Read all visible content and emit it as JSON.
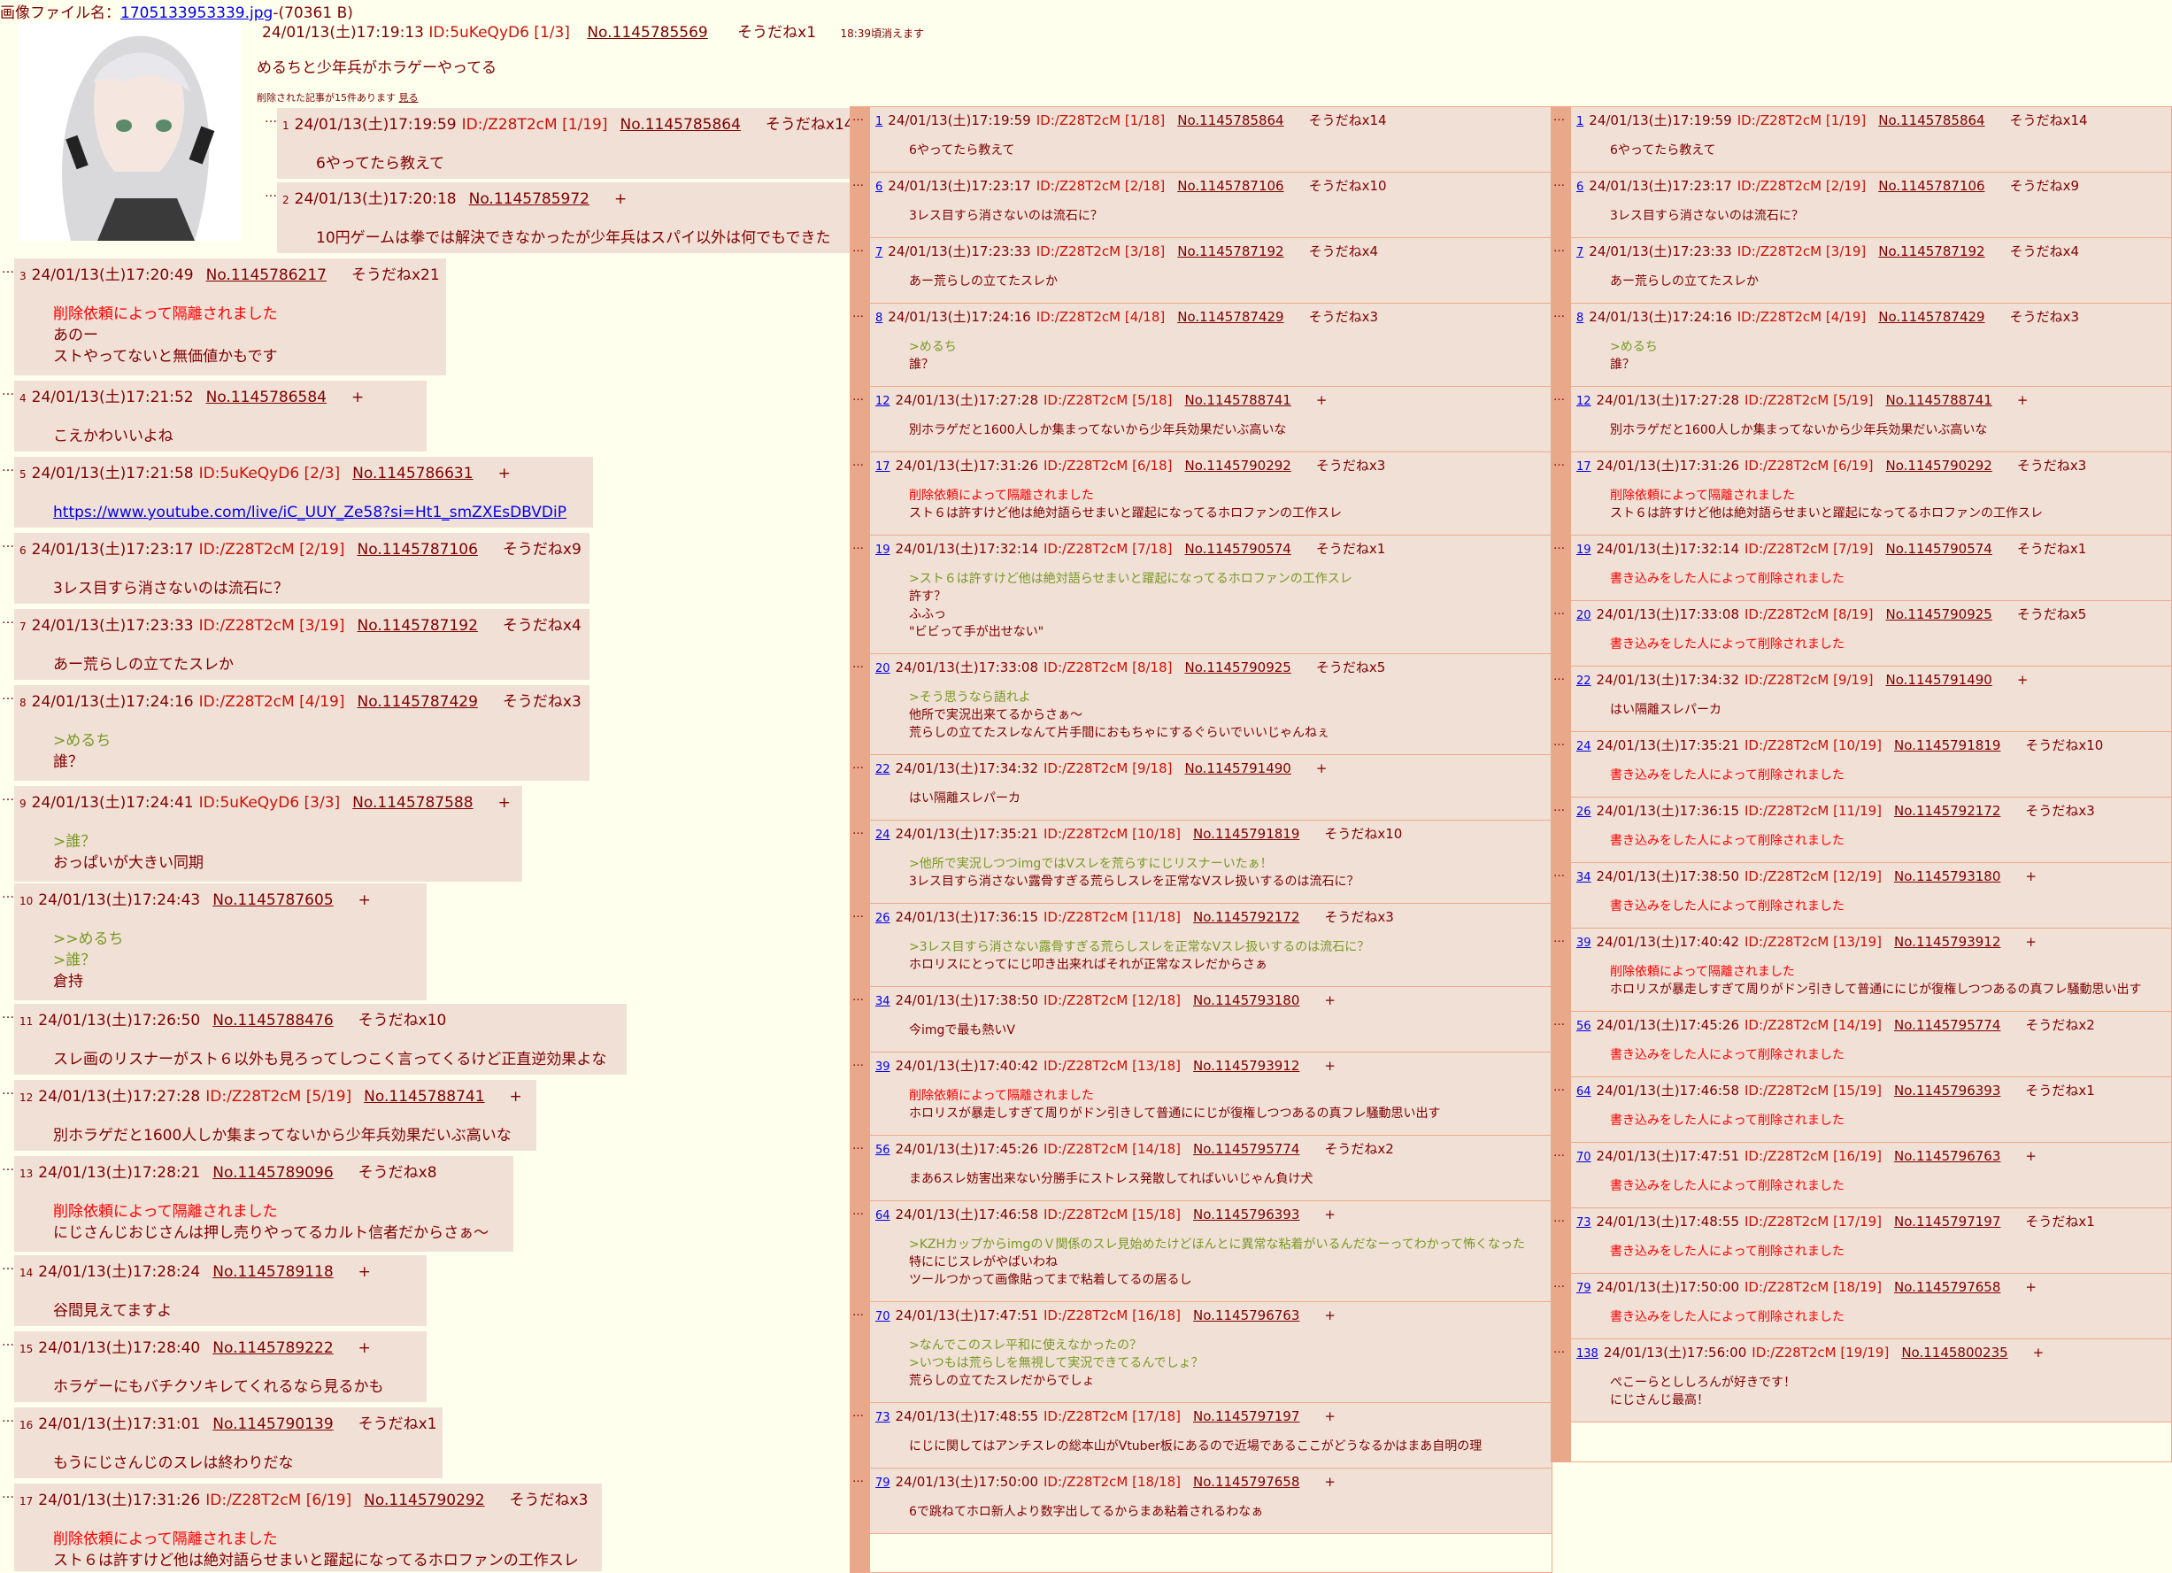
{
  "file": {
    "label": "画像ファイル名：",
    "name": "1705133953339.jpg",
    "size": "-(70361 B)"
  },
  "op": {
    "date": "24/01/13(土)17:19:13",
    "id": "ID:5uKeQyD6 [1/3]",
    "no": "No.1145785569",
    "sod": "そうだねx1",
    "expire": "18:39頃消えます",
    "body": "めるちと少年兵がホラゲーやってる",
    "deleted_note": "削除された記事が15件あります",
    "deleted_link": "見る"
  },
  "thread": [
    {
      "n": "1",
      "date": "24/01/13(土)17:19:59",
      "id": "ID:/Z28T2cM [1/19]",
      "no": "No.1145785864",
      "sod": "そうだねx14",
      "lines": [
        {
          "t": "6やってたら教えて",
          "k": ""
        }
      ]
    },
    {
      "n": "2",
      "date": "24/01/13(土)17:20:18",
      "id": "",
      "no": "No.1145785972",
      "sod": "+",
      "lines": [
        {
          "t": "10円ゲームは拳では解決できなかったが少年兵はスパイ以外は何でもできた",
          "k": ""
        }
      ]
    },
    {
      "n": "3",
      "date": "24/01/13(土)17:20:49",
      "id": "",
      "no": "No.1145786217",
      "sod": "そうだねx21",
      "lines": [
        {
          "t": "削除依頼によって隔離されました",
          "k": "del"
        },
        {
          "t": "あのー",
          "k": ""
        },
        {
          "t": "ストやってないと無価値かもです",
          "k": ""
        }
      ]
    },
    {
      "n": "4",
      "date": "24/01/13(土)17:21:52",
      "id": "",
      "no": "No.1145786584",
      "sod": "+",
      "lines": [
        {
          "t": "こえかわいいよね",
          "k": ""
        }
      ]
    },
    {
      "n": "5",
      "date": "24/01/13(土)17:21:58",
      "id": "ID:5uKeQyD6 [2/3]",
      "no": "No.1145786631",
      "sod": "+",
      "lines": [
        {
          "t": "https://www.youtube.com/live/iC_UUY_Ze58?si=Ht1_smZXEsDBVDiP",
          "k": "link"
        }
      ]
    },
    {
      "n": "6",
      "date": "24/01/13(土)17:23:17",
      "id": "ID:/Z28T2cM [2/19]",
      "no": "No.1145787106",
      "sod": "そうだねx9",
      "lines": [
        {
          "t": "3レス目すら消さないのは流石に？",
          "k": ""
        }
      ]
    },
    {
      "n": "7",
      "date": "24/01/13(土)17:23:33",
      "id": "ID:/Z28T2cM [3/19]",
      "no": "No.1145787192",
      "sod": "そうだねx4",
      "lines": [
        {
          "t": "あー荒らしの立てたスレか",
          "k": ""
        }
      ]
    },
    {
      "n": "8",
      "date": "24/01/13(土)17:24:16",
      "id": "ID:/Z28T2cM [4/19]",
      "no": "No.1145787429",
      "sod": "そうだねx3",
      "lines": [
        {
          "t": ">めるち",
          "k": "quote"
        },
        {
          "t": "誰？",
          "k": ""
        }
      ]
    },
    {
      "n": "9",
      "date": "24/01/13(土)17:24:41",
      "id": "ID:5uKeQyD6 [3/3]",
      "no": "No.1145787588",
      "sod": "+",
      "lines": [
        {
          "t": ">誰？",
          "k": "quote"
        },
        {
          "t": "おっぱいが大きい同期",
          "k": ""
        }
      ]
    },
    {
      "n": "10",
      "date": "24/01/13(土)17:24:43",
      "id": "",
      "no": "No.1145787605",
      "sod": "+",
      "lines": [
        {
          "t": ">>めるち",
          "k": "quote"
        },
        {
          "t": ">誰？",
          "k": "quote"
        },
        {
          "t": "倉持",
          "k": ""
        }
      ]
    },
    {
      "n": "11",
      "date": "24/01/13(土)17:26:50",
      "id": "",
      "no": "No.1145788476",
      "sod": "そうだねx10",
      "lines": [
        {
          "t": "スレ画のリスナーがスト６以外も見ろってしつこく言ってくるけど正直逆効果よな",
          "k": ""
        }
      ]
    },
    {
      "n": "12",
      "date": "24/01/13(土)17:27:28",
      "id": "ID:/Z28T2cM [5/19]",
      "no": "No.1145788741",
      "sod": "+",
      "lines": [
        {
          "t": "別ホラゲだと1600人しか集まってないから少年兵効果だいぶ高いな",
          "k": ""
        }
      ]
    },
    {
      "n": "13",
      "date": "24/01/13(土)17:28:21",
      "id": "",
      "no": "No.1145789096",
      "sod": "そうだねx8",
      "lines": [
        {
          "t": "削除依頼によって隔離されました",
          "k": "del"
        },
        {
          "t": "にじさんじおじさんは押し売りやってるカルト信者だからさぁ～",
          "k": ""
        }
      ]
    },
    {
      "n": "14",
      "date": "24/01/13(土)17:28:24",
      "id": "",
      "no": "No.1145789118",
      "sod": "+",
      "lines": [
        {
          "t": "谷間見えてますよ",
          "k": ""
        }
      ]
    },
    {
      "n": "15",
      "date": "24/01/13(土)17:28:40",
      "id": "",
      "no": "No.1145789222",
      "sod": "+",
      "lines": [
        {
          "t": "ホラゲーにもバチクソキレてくれるなら見るかも",
          "k": ""
        }
      ]
    },
    {
      "n": "16",
      "date": "24/01/13(土)17:31:01",
      "id": "",
      "no": "No.1145790139",
      "sod": "そうだねx1",
      "lines": [
        {
          "t": "もうにじさんじのスレは終わりだな",
          "k": ""
        }
      ]
    },
    {
      "n": "17",
      "date": "24/01/13(土)17:31:26",
      "id": "ID:/Z28T2cM [6/19]",
      "no": "No.1145790292",
      "sod": "そうだねx3",
      "lines": [
        {
          "t": "削除依頼によって隔離されました",
          "k": "del"
        },
        {
          "t": "スト６は許すけど他は絶対語らせまいと躍起になってるホロファンの工作スレ",
          "k": ""
        }
      ]
    }
  ],
  "col1": [
    {
      "n": "1",
      "date": "24/01/13(土)17:19:59",
      "id": "ID:/Z28T2cM [1/18]",
      "no": "No.1145785864",
      "sod": "そうだねx14",
      "lines": [
        {
          "t": "6やってたら教えて",
          "k": ""
        }
      ]
    },
    {
      "n": "6",
      "date": "24/01/13(土)17:23:17",
      "id": "ID:/Z28T2cM [2/18]",
      "no": "No.1145787106",
      "sod": "そうだねx10",
      "lines": [
        {
          "t": "3レス目すら消さないのは流石に？",
          "k": ""
        }
      ]
    },
    {
      "n": "7",
      "date": "24/01/13(土)17:23:33",
      "id": "ID:/Z28T2cM [3/18]",
      "no": "No.1145787192",
      "sod": "そうだねx4",
      "lines": [
        {
          "t": "あー荒らしの立てたスレか",
          "k": ""
        }
      ]
    },
    {
      "n": "8",
      "date": "24/01/13(土)17:24:16",
      "id": "ID:/Z28T2cM [4/18]",
      "no": "No.1145787429",
      "sod": "そうだねx3",
      "lines": [
        {
          "t": ">めるち",
          "k": "quote"
        },
        {
          "t": "誰？",
          "k": ""
        }
      ]
    },
    {
      "n": "12",
      "date": "24/01/13(土)17:27:28",
      "id": "ID:/Z28T2cM [5/18]",
      "no": "No.1145788741",
      "sod": "+",
      "lines": [
        {
          "t": "別ホラゲだと1600人しか集まってないから少年兵効果だいぶ高いな",
          "k": ""
        }
      ]
    },
    {
      "n": "17",
      "date": "24/01/13(土)17:31:26",
      "id": "ID:/Z28T2cM [6/18]",
      "no": "No.1145790292",
      "sod": "そうだねx3",
      "lines": [
        {
          "t": "削除依頼によって隔離されました",
          "k": "del"
        },
        {
          "t": "スト６は許すけど他は絶対語らせまいと躍起になってるホロファンの工作スレ",
          "k": ""
        }
      ]
    },
    {
      "n": "19",
      "date": "24/01/13(土)17:32:14",
      "id": "ID:/Z28T2cM [7/18]",
      "no": "No.1145790574",
      "sod": "そうだねx1",
      "lines": [
        {
          "t": ">スト６は許すけど他は絶対語らせまいと躍起になってるホロファンの工作スレ",
          "k": "quote"
        },
        {
          "t": "許す？",
          "k": ""
        },
        {
          "t": "ふふっ",
          "k": ""
        },
        {
          "t": "\"ビビって手が出せない\"",
          "k": ""
        }
      ]
    },
    {
      "n": "20",
      "date": "24/01/13(土)17:33:08",
      "id": "ID:/Z28T2cM [8/18]",
      "no": "No.1145790925",
      "sod": "そうだねx5",
      "lines": [
        {
          "t": ">そう思うなら語れよ",
          "k": "quote"
        },
        {
          "t": "他所で実況出来てるからさぁ～",
          "k": ""
        },
        {
          "t": "荒らしの立てたスレなんて片手間におもちゃにするぐらいでいいじゃんねぇ",
          "k": ""
        }
      ]
    },
    {
      "n": "22",
      "date": "24/01/13(土)17:34:32",
      "id": "ID:/Z28T2cM [9/18]",
      "no": "No.1145791490",
      "sod": "+",
      "lines": [
        {
          "t": "はい隔離スレパーカ",
          "k": ""
        }
      ]
    },
    {
      "n": "24",
      "date": "24/01/13(土)17:35:21",
      "id": "ID:/Z28T2cM [10/18]",
      "no": "No.1145791819",
      "sod": "そうだねx10",
      "lines": [
        {
          "t": ">他所で実況しつつimgではVスレを荒らすにじリスナーいたぁ！",
          "k": "quote"
        },
        {
          "t": "3レス目すら消さない露骨すぎる荒らしスレを正常なVスレ扱いするのは流石に？",
          "k": ""
        }
      ]
    },
    {
      "n": "26",
      "date": "24/01/13(土)17:36:15",
      "id": "ID:/Z28T2cM [11/18]",
      "no": "No.1145792172",
      "sod": "そうだねx3",
      "lines": [
        {
          "t": ">3レス目すら消さない露骨すぎる荒らしスレを正常なVスレ扱いするのは流石に？",
          "k": "quote"
        },
        {
          "t": "ホロリスにとってにじ叩き出来ればそれが正常なスレだからさぁ",
          "k": ""
        }
      ]
    },
    {
      "n": "34",
      "date": "24/01/13(土)17:38:50",
      "id": "ID:/Z28T2cM [12/18]",
      "no": "No.1145793180",
      "sod": "+",
      "lines": [
        {
          "t": "今imgで最も熱いV",
          "k": ""
        }
      ]
    },
    {
      "n": "39",
      "date": "24/01/13(土)17:40:42",
      "id": "ID:/Z28T2cM [13/18]",
      "no": "No.1145793912",
      "sod": "+",
      "lines": [
        {
          "t": "削除依頼によって隔離されました",
          "k": "del"
        },
        {
          "t": "ホロリスが暴走しすぎて周りがドン引きして普通ににじが復権しつつあるの真フレ騒動思い出す",
          "k": ""
        }
      ]
    },
    {
      "n": "56",
      "date": "24/01/13(土)17:45:26",
      "id": "ID:/Z28T2cM [14/18]",
      "no": "No.1145795774",
      "sod": "そうだねx2",
      "lines": [
        {
          "t": "まあ6スレ妨害出来ない分勝手にストレス発散してればいいじゃん負け犬",
          "k": ""
        }
      ]
    },
    {
      "n": "64",
      "date": "24/01/13(土)17:46:58",
      "id": "ID:/Z28T2cM [15/18]",
      "no": "No.1145796393",
      "sod": "+",
      "lines": [
        {
          "t": ">KZHカップからimgのＶ関係のスレ見始めたけどほんとに異常な粘着がいるんだなーってわかって怖くなった",
          "k": "quote"
        },
        {
          "t": "特ににじスレがやばいわね",
          "k": ""
        },
        {
          "t": "ツールつかって画像貼ってまで粘着してるの居るし",
          "k": ""
        }
      ]
    },
    {
      "n": "70",
      "date": "24/01/13(土)17:47:51",
      "id": "ID:/Z28T2cM [16/18]",
      "no": "No.1145796763",
      "sod": "+",
      "lines": [
        {
          "t": ">なんでこのスレ平和に使えなかったの？",
          "k": "quote"
        },
        {
          "t": ">いつもは荒らしを無視して実況できてるんでしょ？",
          "k": "quote"
        },
        {
          "t": "荒らしの立てたスレだからでしょ",
          "k": ""
        }
      ]
    },
    {
      "n": "73",
      "date": "24/01/13(土)17:48:55",
      "id": "ID:/Z28T2cM [17/18]",
      "no": "No.1145797197",
      "sod": "+",
      "lines": [
        {
          "t": "にじに関してはアンチスレの総本山がVtuber板にあるので近場であるここがどうなるかはまあ自明の理",
          "k": ""
        }
      ]
    },
    {
      "n": "79",
      "date": "24/01/13(土)17:50:00",
      "id": "ID:/Z28T2cM [18/18]",
      "no": "No.1145797658",
      "sod": "+",
      "lines": [
        {
          "t": "6で跳ねてホロ新人より数字出してるからまあ粘着されるわなぁ",
          "k": ""
        }
      ]
    }
  ],
  "col2": [
    {
      "n": "1",
      "date": "24/01/13(土)17:19:59",
      "id": "ID:/Z28T2cM [1/19]",
      "no": "No.1145785864",
      "sod": "そうだねx14",
      "lines": [
        {
          "t": "6やってたら教えて",
          "k": ""
        }
      ]
    },
    {
      "n": "6",
      "date": "24/01/13(土)17:23:17",
      "id": "ID:/Z28T2cM [2/19]",
      "no": "No.1145787106",
      "sod": "そうだねx9",
      "lines": [
        {
          "t": "3レス目すら消さないのは流石に？",
          "k": ""
        }
      ]
    },
    {
      "n": "7",
      "date": "24/01/13(土)17:23:33",
      "id": "ID:/Z28T2cM [3/19]",
      "no": "No.1145787192",
      "sod": "そうだねx4",
      "lines": [
        {
          "t": "あー荒らしの立てたスレか",
          "k": ""
        }
      ]
    },
    {
      "n": "8",
      "date": "24/01/13(土)17:24:16",
      "id": "ID:/Z28T2cM [4/19]",
      "no": "No.1145787429",
      "sod": "そうだねx3",
      "lines": [
        {
          "t": ">めるち",
          "k": "quote"
        },
        {
          "t": "誰？",
          "k": ""
        }
      ]
    },
    {
      "n": "12",
      "date": "24/01/13(土)17:27:28",
      "id": "ID:/Z28T2cM [5/19]",
      "no": "No.1145788741",
      "sod": "+",
      "lines": [
        {
          "t": "別ホラゲだと1600人しか集まってないから少年兵効果だいぶ高いな",
          "k": ""
        }
      ]
    },
    {
      "n": "17",
      "date": "24/01/13(土)17:31:26",
      "id": "ID:/Z28T2cM [6/19]",
      "no": "No.1145790292",
      "sod": "そうだねx3",
      "lines": [
        {
          "t": "削除依頼によって隔離されました",
          "k": "del"
        },
        {
          "t": "スト６は許すけど他は絶対語らせまいと躍起になってるホロファンの工作スレ",
          "k": ""
        }
      ]
    },
    {
      "n": "19",
      "date": "24/01/13(土)17:32:14",
      "id": "ID:/Z28T2cM [7/19]",
      "no": "No.1145790574",
      "sod": "そうだねx1",
      "lines": [
        {
          "t": "書き込みをした人によって削除されました",
          "k": "del"
        }
      ]
    },
    {
      "n": "20",
      "date": "24/01/13(土)17:33:08",
      "id": "ID:/Z28T2cM [8/19]",
      "no": "No.1145790925",
      "sod": "そうだねx5",
      "lines": [
        {
          "t": "書き込みをした人によって削除されました",
          "k": "del"
        }
      ]
    },
    {
      "n": "22",
      "date": "24/01/13(土)17:34:32",
      "id": "ID:/Z28T2cM [9/19]",
      "no": "No.1145791490",
      "sod": "+",
      "lines": [
        {
          "t": "はい隔離スレパーカ",
          "k": ""
        }
      ]
    },
    {
      "n": "24",
      "date": "24/01/13(土)17:35:21",
      "id": "ID:/Z28T2cM [10/19]",
      "no": "No.1145791819",
      "sod": "そうだねx10",
      "lines": [
        {
          "t": "書き込みをした人によって削除されました",
          "k": "del"
        }
      ]
    },
    {
      "n": "26",
      "date": "24/01/13(土)17:36:15",
      "id": "ID:/Z28T2cM [11/19]",
      "no": "No.1145792172",
      "sod": "そうだねx3",
      "lines": [
        {
          "t": "書き込みをした人によって削除されました",
          "k": "del"
        }
      ]
    },
    {
      "n": "34",
      "date": "24/01/13(土)17:38:50",
      "id": "ID:/Z28T2cM [12/19]",
      "no": "No.1145793180",
      "sod": "+",
      "lines": [
        {
          "t": "書き込みをした人によって削除されました",
          "k": "del"
        }
      ]
    },
    {
      "n": "39",
      "date": "24/01/13(土)17:40:42",
      "id": "ID:/Z28T2cM [13/19]",
      "no": "No.1145793912",
      "sod": "+",
      "lines": [
        {
          "t": "削除依頼によって隔離されました",
          "k": "del"
        },
        {
          "t": "ホロリスが暴走しすぎて周りがドン引きして普通ににじが復権しつつあるの真フレ騒動思い出す",
          "k": ""
        }
      ]
    },
    {
      "n": "56",
      "date": "24/01/13(土)17:45:26",
      "id": "ID:/Z28T2cM [14/19]",
      "no": "No.1145795774",
      "sod": "そうだねx2",
      "lines": [
        {
          "t": "書き込みをした人によって削除されました",
          "k": "del"
        }
      ]
    },
    {
      "n": "64",
      "date": "24/01/13(土)17:46:58",
      "id": "ID:/Z28T2cM [15/19]",
      "no": "No.1145796393",
      "sod": "そうだねx1",
      "lines": [
        {
          "t": "書き込みをした人によって削除されました",
          "k": "del"
        }
      ]
    },
    {
      "n": "70",
      "date": "24/01/13(土)17:47:51",
      "id": "ID:/Z28T2cM [16/19]",
      "no": "No.1145796763",
      "sod": "+",
      "lines": [
        {
          "t": "書き込みをした人によって削除されました",
          "k": "del"
        }
      ]
    },
    {
      "n": "73",
      "date": "24/01/13(土)17:48:55",
      "id": "ID:/Z28T2cM [17/19]",
      "no": "No.1145797197",
      "sod": "そうだねx1",
      "lines": [
        {
          "t": "書き込みをした人によって削除されました",
          "k": "del"
        }
      ]
    },
    {
      "n": "79",
      "date": "24/01/13(土)17:50:00",
      "id": "ID:/Z28T2cM [18/19]",
      "no": "No.1145797658",
      "sod": "+",
      "lines": [
        {
          "t": "書き込みをした人によって削除されました",
          "k": "del"
        }
      ]
    },
    {
      "n": "138",
      "date": "24/01/13(土)17:56:00",
      "id": "ID:/Z28T2cM [19/19]",
      "no": "No.1145800235",
      "sod": "+",
      "lines": [
        {
          "t": "ぺこーらとししろんが好きです！",
          "k": ""
        },
        {
          "t": "にじさんじ最高！",
          "k": ""
        }
      ]
    }
  ],
  "colors": {
    "bg": "#ffffee",
    "post": "#f0e0d6",
    "name": "#800000",
    "id": "#cc1105",
    "quote": "#789922",
    "deleted": "#ff0000",
    "link": "#0000ee",
    "popup_bar": "#eaa88a"
  }
}
